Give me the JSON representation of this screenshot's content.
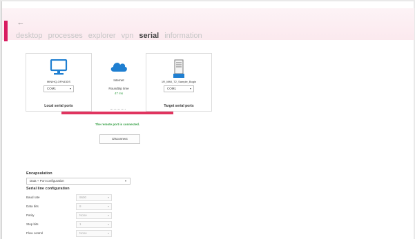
{
  "window": {
    "controls": "– □"
  },
  "nav": {
    "back_icon": "back-arrow-icon",
    "items": [
      {
        "label": "desktop",
        "active": false
      },
      {
        "label": "processes",
        "active": false
      },
      {
        "label": "explorer",
        "active": false
      },
      {
        "label": "vpn",
        "active": false
      },
      {
        "label": "serial",
        "active": true
      },
      {
        "label": "information",
        "active": false
      }
    ]
  },
  "local": {
    "device_name": "MINIHQ-OFN43DS",
    "port": "COM1",
    "title": "Local serial ports",
    "icon": "monitor-icon"
  },
  "internet": {
    "label": "Internet",
    "roundtrip_label": "Roundtrip time",
    "roundtrip_value": "47 ms",
    "icon": "cloud-icon"
  },
  "target": {
    "device_name": "1R_MMI_T2_Sample_Bogin",
    "port": "COM1",
    "title": "Target serial ports",
    "icon": "server-icon"
  },
  "connection": {
    "status": "The remote port is connected.",
    "disconnect_label": "Disconnect",
    "accent_color": "#e0345f",
    "status_color": "#2e9c3e"
  },
  "encapsulation": {
    "label": "Encapsulation",
    "value": "Data + Port configuration"
  },
  "serial_config": {
    "label": "Serial line configuration",
    "rows": [
      {
        "label": "Baud rate",
        "value": "9600"
      },
      {
        "label": "Data bits",
        "value": "8"
      },
      {
        "label": "Parity",
        "value": "None"
      },
      {
        "label": "Stop bits",
        "value": "1"
      },
      {
        "label": "Flow control",
        "value": "None"
      }
    ]
  }
}
